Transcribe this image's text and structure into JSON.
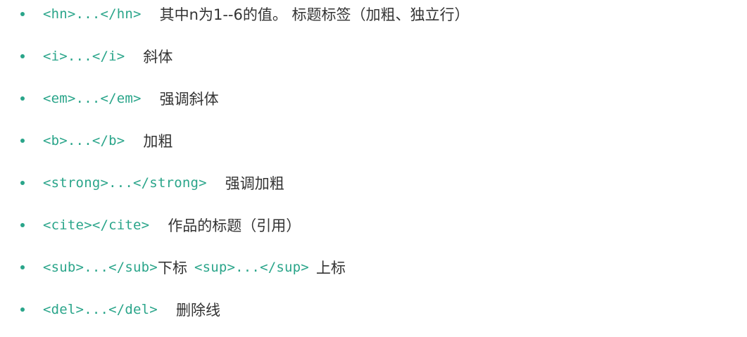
{
  "items": [
    {
      "code": "<hn>...</hn>",
      "desc": "其中n为1--6的值。 标题标签（加粗、独立行）"
    },
    {
      "code": "<i>...</i>",
      "desc": "斜体"
    },
    {
      "code": "<em>...</em>",
      "desc": "强调斜体"
    },
    {
      "code": "<b>...</b>",
      "desc": "加粗"
    },
    {
      "code": "<strong>...</strong>",
      "desc": "强调加粗"
    },
    {
      "code": "<cite></cite>",
      "desc": "作品的标题（引用）"
    },
    {
      "code": "<sub>...</sub>",
      "desc": "下标",
      "code2": "<sup>...</sup>",
      "desc2": "上标"
    },
    {
      "code": "<del>...</del>",
      "desc": "删除线"
    }
  ],
  "colors": {
    "code": "#2aa58a",
    "text": "#333333",
    "bullet": "#2aa58a"
  }
}
